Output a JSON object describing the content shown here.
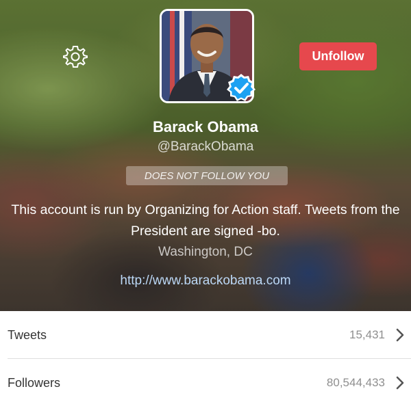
{
  "profile": {
    "name": "Barack Obama",
    "handle": "@BarackObama",
    "follow_status": "DOES NOT FOLLOW YOU",
    "bio": "This account is run by Organizing for Action staff. Tweets from the President are signed -bo.",
    "location": "Washington, DC",
    "website": "http://www.barackobama.com",
    "verified": true
  },
  "actions": {
    "unfollow_label": "Unfollow",
    "settings_icon": "gear-icon"
  },
  "stats": [
    {
      "label": "Tweets",
      "value": "15,431"
    },
    {
      "label": "Followers",
      "value": "80,544,433"
    }
  ],
  "colors": {
    "unfollow_button": "#e6484d",
    "verified_badge": "#1da1f2",
    "link": "#bcd8f6"
  }
}
